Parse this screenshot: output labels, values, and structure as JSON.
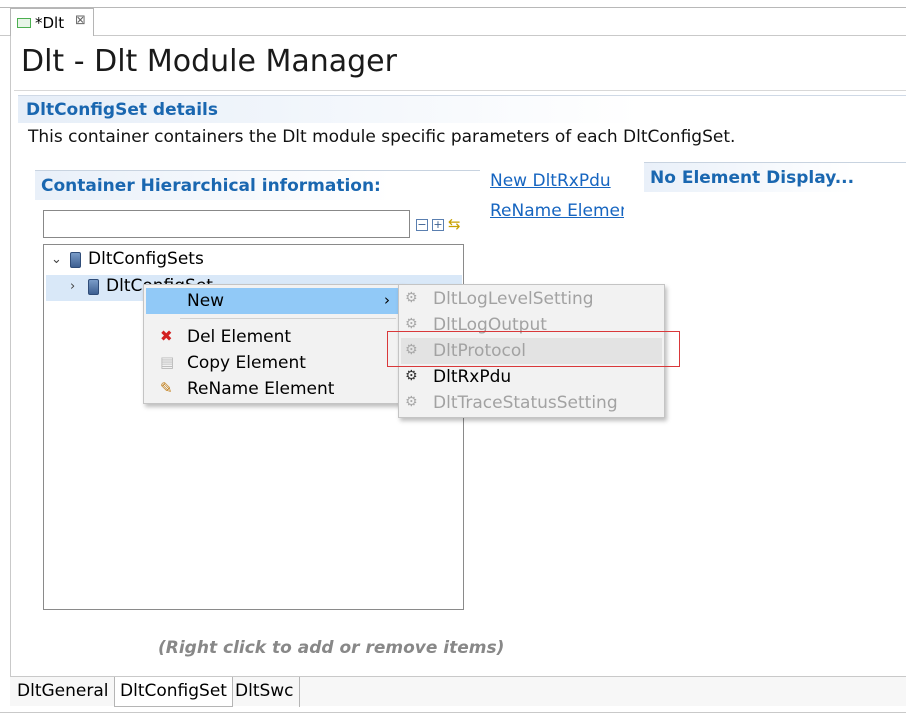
{
  "editor_tab": {
    "title": "*Dlt",
    "close": "⊠"
  },
  "page_title": "Dlt - Dlt Module Manager",
  "section": {
    "title": "DltConfigSet details",
    "description": "This container containers the Dlt module specific parameters of each DltConfigSet."
  },
  "hierarchy": {
    "title": "Container Hierarchical information:",
    "filter_value": "",
    "tree": [
      {
        "label": "DltConfigSets",
        "expanded": true
      },
      {
        "label": "DltConfigSet",
        "expanded": false,
        "selected": true
      }
    ]
  },
  "links": {
    "new": "New DltRxPdu",
    "rename": "ReName Element"
  },
  "no_element_display": "No Element Display...",
  "hint": "(Right click to add or remove items)",
  "bottom_tabs": [
    "DltGeneral",
    "DltConfigSet",
    "DltSwc"
  ],
  "context_menu": {
    "new": "New",
    "del": "Del Element",
    "copy": "Copy Element",
    "rename": "ReName Element"
  },
  "submenu": [
    {
      "label": "DltLogLevelSetting",
      "enabled": false
    },
    {
      "label": "DltLogOutput",
      "enabled": false
    },
    {
      "label": "DltProtocol",
      "enabled": false
    },
    {
      "label": "DltRxPdu",
      "enabled": true
    },
    {
      "label": "DltTraceStatusSetting",
      "enabled": false
    }
  ],
  "colors": {
    "accent": "#1a67b0",
    "link": "#1665c0",
    "menu_hover": "#91c9f7",
    "highlight": "#d9383a"
  }
}
